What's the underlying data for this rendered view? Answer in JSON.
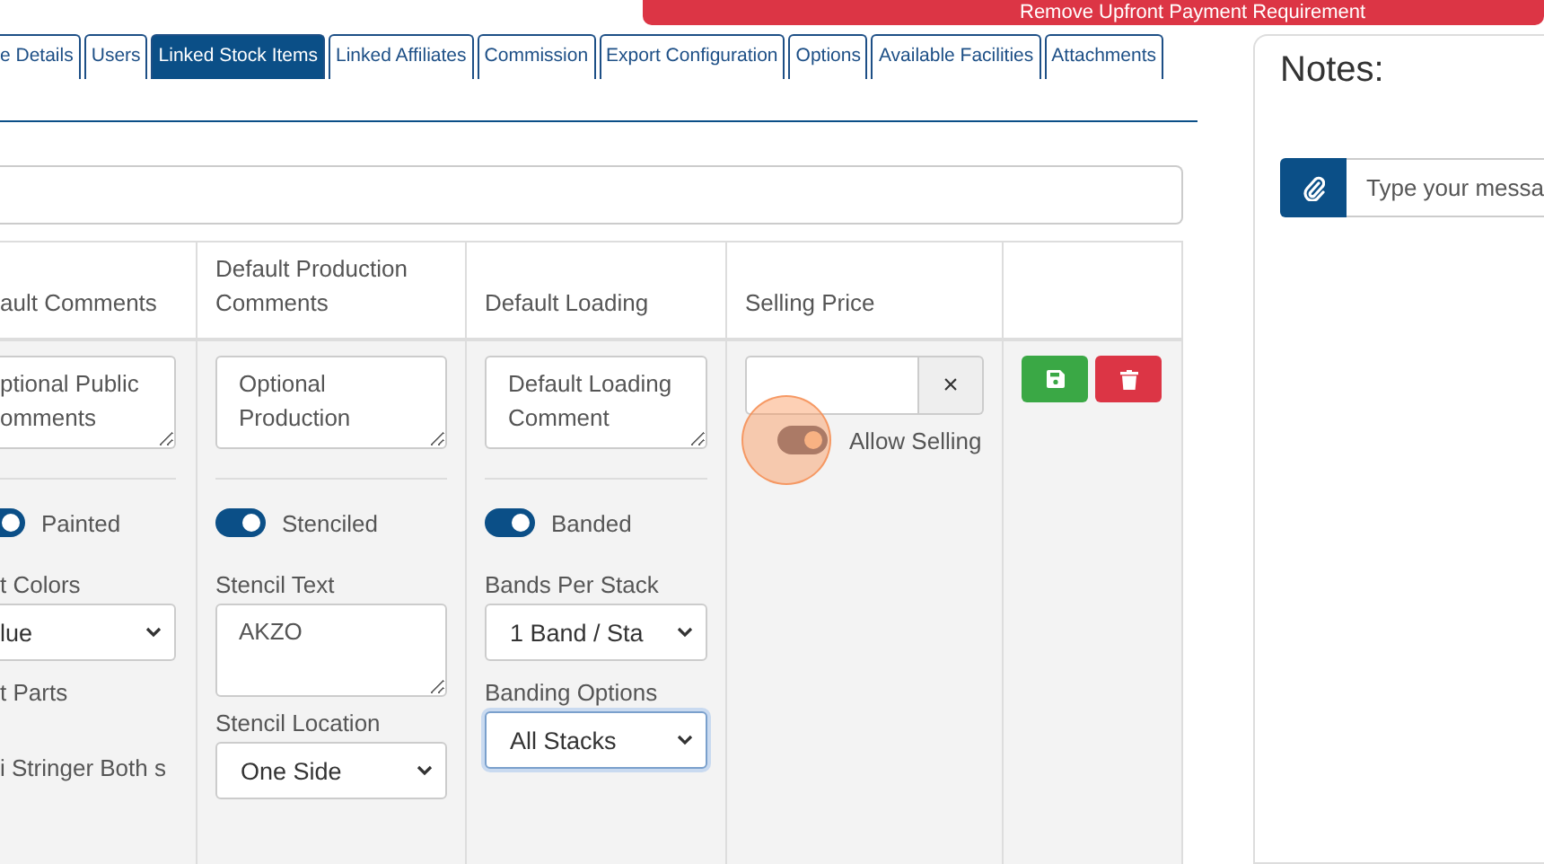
{
  "banner": {
    "text": "Remove Upfront Payment Requirement"
  },
  "tabs": [
    {
      "label": "e Details",
      "selected": false
    },
    {
      "label": "Users",
      "selected": false
    },
    {
      "label": "Linked Stock Items",
      "selected": true
    },
    {
      "label": "Linked Affiliates",
      "selected": false
    },
    {
      "label": "Commission",
      "selected": false
    },
    {
      "label": "Export Configuration",
      "selected": false
    },
    {
      "label": "Options",
      "selected": false
    },
    {
      "label": "Available Facilities",
      "selected": false
    },
    {
      "label": "Attachments",
      "selected": false
    }
  ],
  "table": {
    "columns": [
      "ault Comments",
      "Default Production Comments",
      "Default Loading",
      "Selling Price"
    ],
    "cells": [
      [
        {
          "kind": "textarea",
          "placeholder": "ptional Public omments"
        },
        {
          "kind": "divider"
        },
        {
          "kind": "toggle",
          "label": "Painted",
          "on": true
        },
        {
          "kind": "label",
          "text": "t Colors"
        },
        {
          "kind": "select",
          "value": "lue",
          "focused": false
        },
        {
          "kind": "label",
          "text": "t Parts"
        },
        {
          "kind": "text",
          "text": "i Stringer Both s"
        }
      ],
      [
        {
          "kind": "textarea",
          "placeholder": "Optional Production"
        },
        {
          "kind": "divider"
        },
        {
          "kind": "toggle",
          "label": "Stenciled",
          "on": true
        },
        {
          "kind": "label",
          "text": "Stencil Text"
        },
        {
          "kind": "textarea",
          "value": "AKZO"
        },
        {
          "kind": "label",
          "text": "Stencil Location"
        },
        {
          "kind": "select",
          "value": "One Side",
          "focused": false
        }
      ],
      [
        {
          "kind": "textarea",
          "placeholder": "Default Loading Comment"
        },
        {
          "kind": "divider"
        },
        {
          "kind": "toggle",
          "label": "Banded",
          "on": true
        },
        {
          "kind": "label",
          "text": "Bands Per Stack"
        },
        {
          "kind": "select",
          "value": "1 Band / Sta",
          "focused": false
        },
        {
          "kind": "label",
          "text": "Banding Options"
        },
        {
          "kind": "select",
          "value": "All Stacks",
          "focused": true
        }
      ],
      [
        {
          "kind": "price",
          "clear": "×"
        },
        {
          "kind": "toggle",
          "label": "Allow Selling",
          "on": true,
          "highlighted": true
        }
      ]
    ],
    "actions": [
      {
        "kind": "save"
      },
      {
        "kind": "delete"
      }
    ]
  },
  "notes": {
    "title": "Notes:",
    "message": {
      "placeholder": "Type your messa"
    }
  }
}
